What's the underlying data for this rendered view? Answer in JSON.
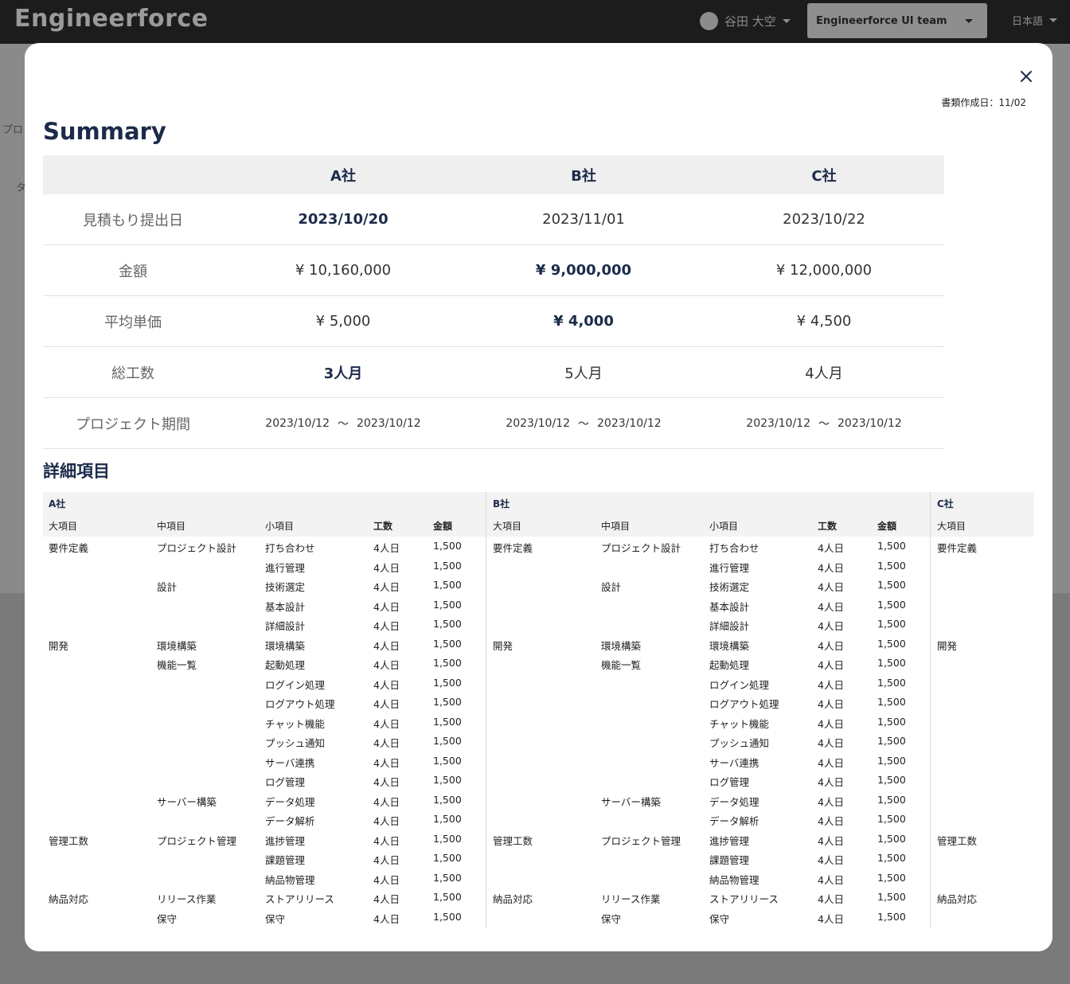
{
  "app": {
    "logo": "Engineerforce",
    "user_name": "谷田 大空",
    "team": "Engineerforce UI team",
    "language": "日本語"
  },
  "background": {
    "fragments": [
      "プロ",
      "タ"
    ]
  },
  "modal": {
    "doc_date": "書類作成日：11/02",
    "summary_title": "Summary",
    "detail_title": "詳細項目"
  },
  "summary": {
    "companies": [
      "A社",
      "B社",
      "C社"
    ],
    "rows": [
      {
        "label": "見積もり提出日",
        "values": [
          "2023/10/20",
          "2023/11/01",
          "2023/10/22"
        ],
        "best": 0
      },
      {
        "label": "金額",
        "values": [
          "¥ 10,160,000",
          "¥ 9,000,000",
          "¥ 12,000,000"
        ],
        "best": 1
      },
      {
        "label": "平均単価",
        "values": [
          "¥ 5,000",
          "¥ 4,000",
          "¥ 4,500"
        ],
        "best": 1
      },
      {
        "label": "総工数",
        "values": [
          "3人月",
          "5人月",
          "4人月"
        ],
        "best": 0
      }
    ],
    "period": {
      "label": "プロジェクト期間",
      "values": [
        {
          "start": "2023/10/12",
          "end": "2023/10/12"
        },
        {
          "start": "2023/10/12",
          "end": "2023/10/12"
        },
        {
          "start": "2023/10/12",
          "end": "2023/10/12"
        }
      ],
      "separator": "〜"
    }
  },
  "detail": {
    "columns": [
      "大項目",
      "中項目",
      "小項目",
      "工数",
      "金額"
    ],
    "companies": [
      "A社",
      "B社",
      "C社"
    ],
    "rows": [
      [
        "要件定義",
        "プロジェクト設計",
        "打ち合わせ",
        "4人日",
        "1,500"
      ],
      [
        "",
        "",
        "進行管理",
        "4人日",
        "1,500"
      ],
      [
        "",
        "設計",
        "技術選定",
        "4人日",
        "1,500"
      ],
      [
        "",
        "",
        "基本設計",
        "4人日",
        "1,500"
      ],
      [
        "",
        "",
        "詳細設計",
        "4人日",
        "1,500"
      ],
      [
        "開発",
        "環境構築",
        "環境構築",
        "4人日",
        "1,500"
      ],
      [
        "",
        "機能一覧",
        "起動処理",
        "4人日",
        "1,500"
      ],
      [
        "",
        "",
        "ログイン処理",
        "4人日",
        "1,500"
      ],
      [
        "",
        "",
        "ログアウト処理",
        "4人日",
        "1,500"
      ],
      [
        "",
        "",
        "チャット機能",
        "4人日",
        "1,500"
      ],
      [
        "",
        "",
        "プッシュ通知",
        "4人日",
        "1,500"
      ],
      [
        "",
        "",
        "サーバ連携",
        "4人日",
        "1,500"
      ],
      [
        "",
        "",
        "ログ管理",
        "4人日",
        "1,500"
      ],
      [
        "",
        "サーバー構築",
        "データ処理",
        "4人日",
        "1,500"
      ],
      [
        "",
        "",
        "データ解析",
        "4人日",
        "1,500"
      ],
      [
        "管理工数",
        "プロジェクト管理",
        "進捗管理",
        "4人日",
        "1,500"
      ],
      [
        "",
        "",
        "課題管理",
        "4人日",
        "1,500"
      ],
      [
        "",
        "",
        "納品物管理",
        "4人日",
        "1,500"
      ],
      [
        "納品対応",
        "リリース作業",
        "ストアリリース",
        "4人日",
        "1,500"
      ],
      [
        "",
        "保守",
        "保守",
        "4人日",
        "1,500"
      ]
    ]
  }
}
